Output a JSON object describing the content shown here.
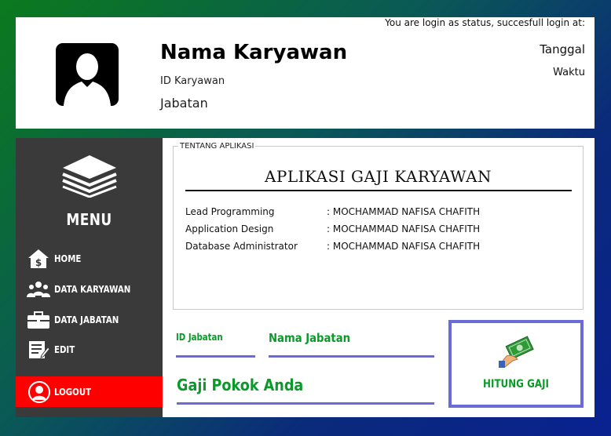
{
  "header": {
    "employee_name": "Nama Karyawan",
    "employee_id": "ID Karyawan",
    "position": "Jabatan",
    "login_status": "You are login as  status,  succesfull login at:",
    "date": "Tanggal",
    "time": "Waktu"
  },
  "sidebar": {
    "menu_title": "MENU",
    "items": [
      {
        "label": "HOME",
        "icon": "house-dollar-icon"
      },
      {
        "label": "DATA KARYAWAN",
        "icon": "people-group-icon"
      },
      {
        "label": "DATA JABATAN",
        "icon": "briefcase-icon"
      },
      {
        "label": "EDIT",
        "icon": "edit-document-icon"
      }
    ],
    "logout": {
      "label": "LOGOUT",
      "icon": "user-icon"
    }
  },
  "about": {
    "legend": "TENTANG APLIKASI",
    "title": "APLIKASI GAJI  KARYAWAN",
    "credits": [
      {
        "role": "Lead Programming",
        "name": ": MOCHAMMAD NAFISA CHAFITH"
      },
      {
        "role": "Application Design",
        "name": ": MOCHAMMAD NAFISA CHAFITH"
      },
      {
        "role": "Database Administrator",
        "name": ": MOCHAMMAD NAFISA CHAFITH"
      }
    ]
  },
  "form": {
    "id_jabatan_label": "ID Jabatan",
    "nama_jabatan_label": "Nama Jabatan",
    "gaji_pokok_label": "Gaji Pokok Anda"
  },
  "hitung_button": {
    "label": "HITUNG GAJI",
    "icon": "money-hand-icon"
  },
  "colors": {
    "accent_green": "#0a9a2a",
    "line_blue": "#6a6ad8",
    "logout_red": "#ff0000",
    "sidebar_bg": "#3a3a3a"
  }
}
